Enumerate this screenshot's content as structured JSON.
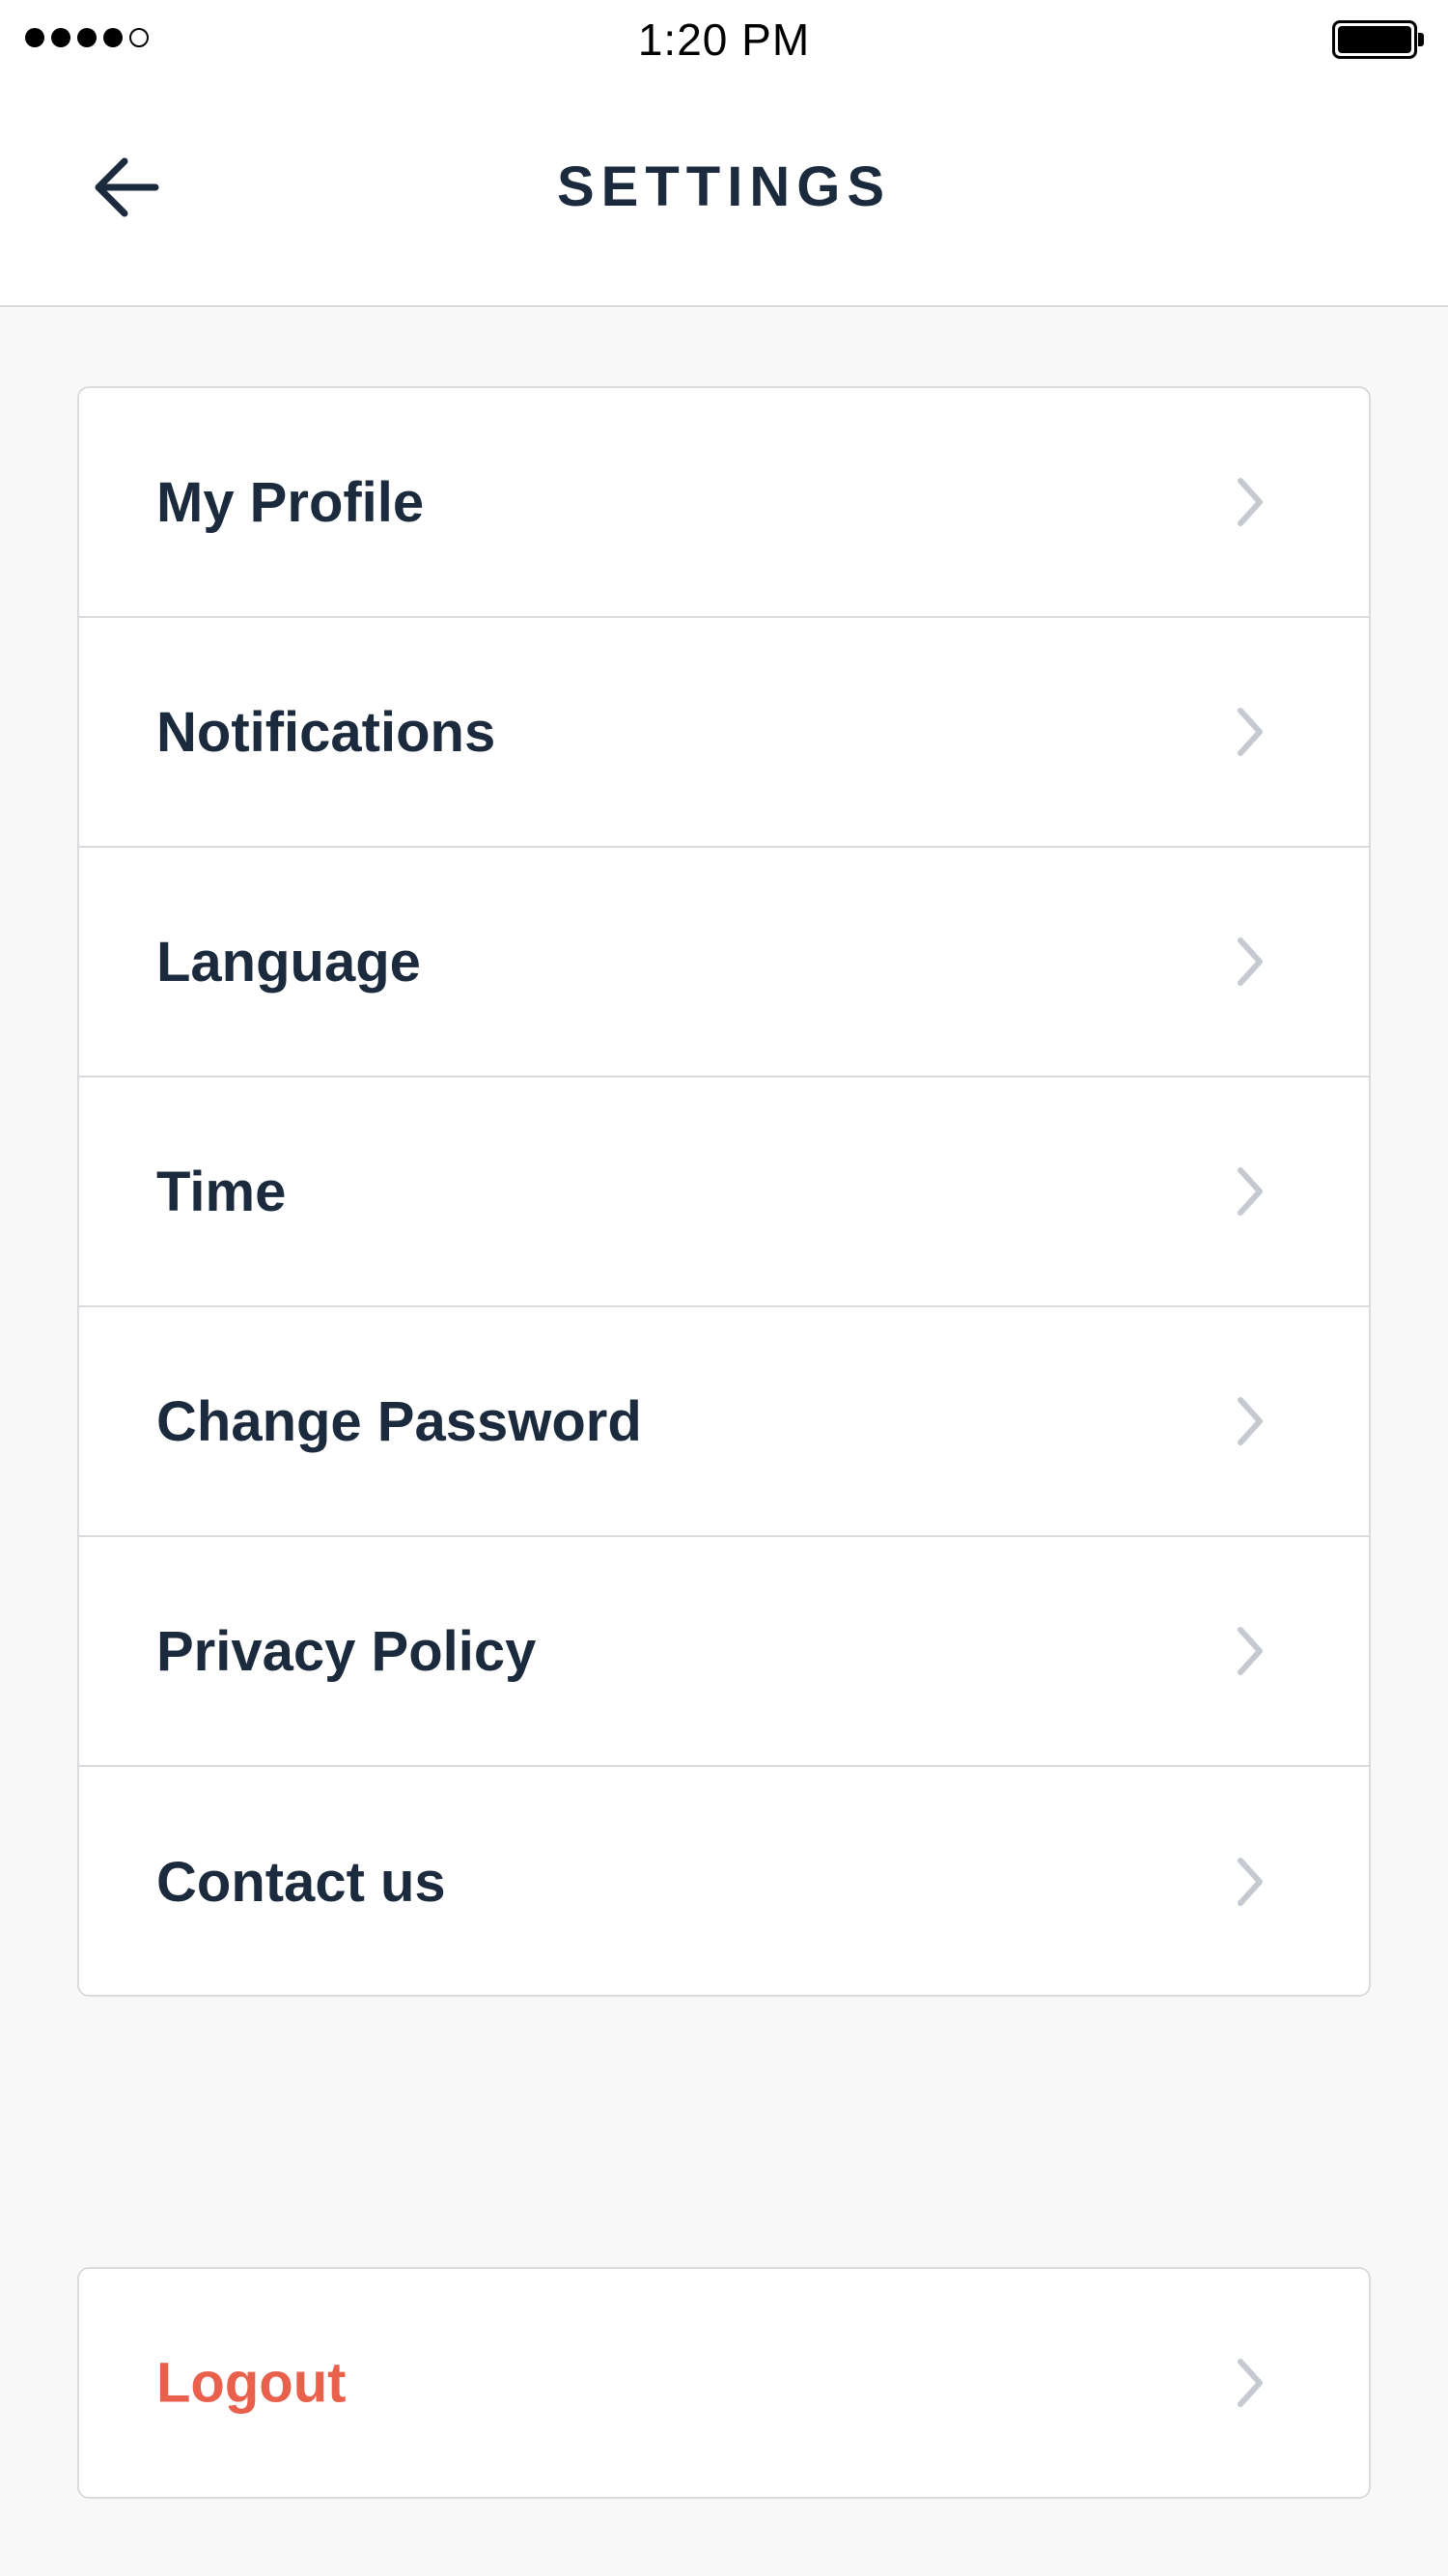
{
  "status_bar": {
    "time": "1:20 PM",
    "signal_bars_filled": 4,
    "signal_bars_total": 5,
    "battery_level": 1.0
  },
  "header": {
    "title": "SETTINGS",
    "back_icon": "arrow-left-icon"
  },
  "menu": {
    "items": [
      {
        "label": "My Profile"
      },
      {
        "label": "Notifications"
      },
      {
        "label": "Language"
      },
      {
        "label": "Time"
      },
      {
        "label": "Change Password"
      },
      {
        "label": "Privacy Policy"
      },
      {
        "label": "Contact us"
      }
    ],
    "item_icon": "chevron-right-icon"
  },
  "logout": {
    "label": "Logout"
  },
  "colors": {
    "text_primary": "#1b2a3d",
    "logout": "#e9604c",
    "chevron": "#c5c9d0",
    "divider": "#d9dbde",
    "background": "#f8f8f8"
  }
}
